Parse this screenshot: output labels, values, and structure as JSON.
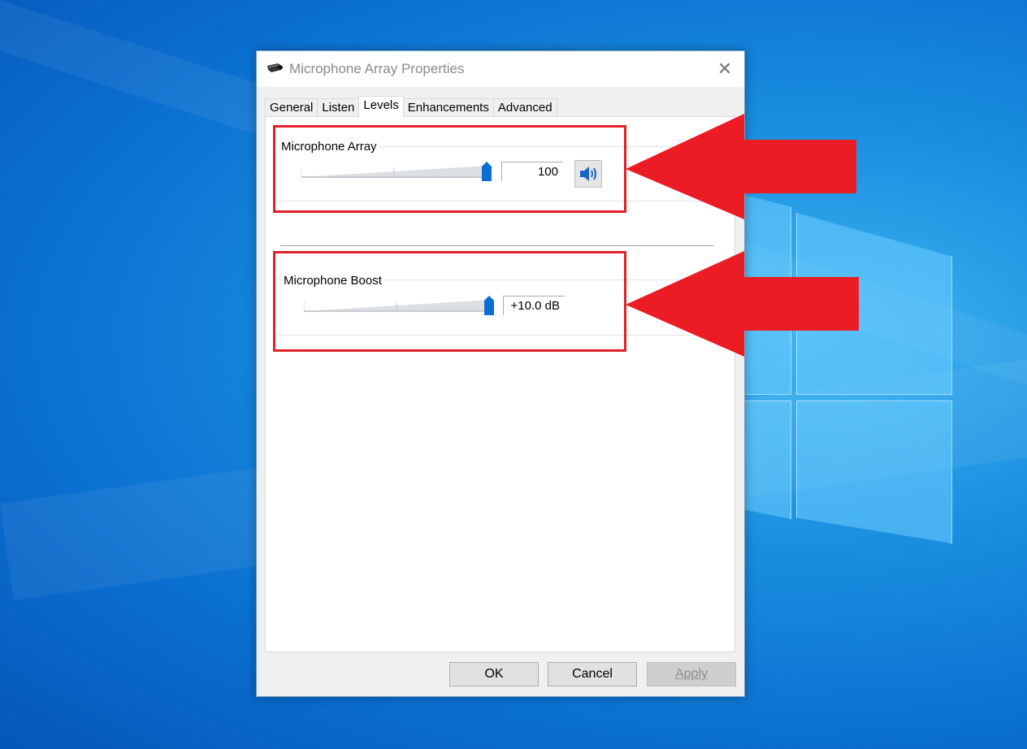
{
  "dialog": {
    "title": "Microphone Array Properties",
    "close_glyph": "✕"
  },
  "tabs": [
    {
      "label": "General"
    },
    {
      "label": "Listen"
    },
    {
      "label": "Levels"
    },
    {
      "label": "Enhancements"
    },
    {
      "label": "Advanced"
    }
  ],
  "active_tab": "Levels",
  "levels": {
    "microphone": {
      "label": "Microphone Array",
      "value": "100",
      "level_percent": 100,
      "mute_icon": "speaker-icon"
    },
    "boost": {
      "label": "Microphone Boost",
      "value": "+10.0 dB",
      "level_percent": 100
    }
  },
  "buttons": {
    "ok": "OK",
    "cancel": "Cancel",
    "apply": "Apply"
  },
  "colors": {
    "highlight": "#e02027",
    "slider_thumb": "#0a6fd0"
  }
}
